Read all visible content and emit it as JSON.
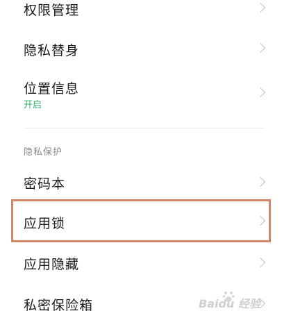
{
  "items": [
    {
      "label": "权限管理"
    },
    {
      "label": "隐私替身"
    },
    {
      "label": "位置信息",
      "status": "开启"
    },
    {
      "label": "密码本"
    },
    {
      "label": "应用锁"
    },
    {
      "label": "应用隐藏"
    },
    {
      "label": "私密保险箱"
    }
  ],
  "section_title": "隐私保护",
  "watermark": "Baidu 经验",
  "colors": {
    "status_green": "#2fb36a",
    "highlight_border": "#d4866a",
    "section_gray": "#8a8a8a"
  }
}
